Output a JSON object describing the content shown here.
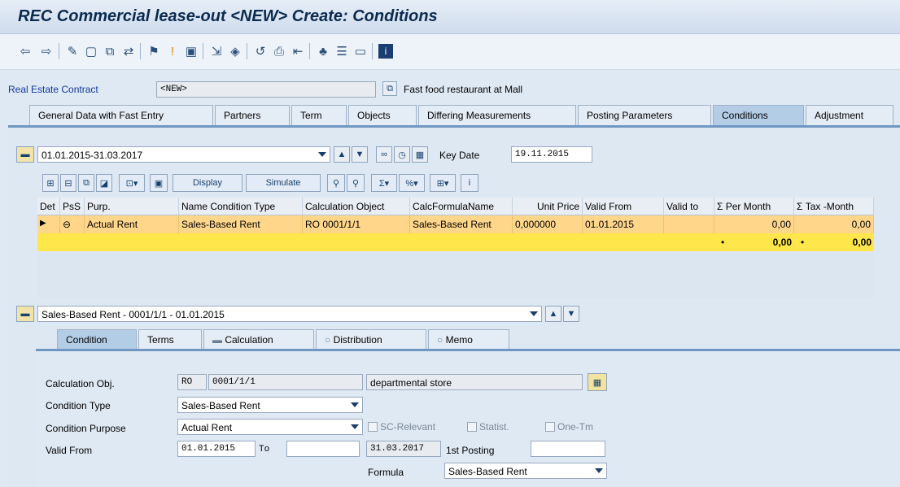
{
  "window": {
    "title": "REC Commercial lease-out <NEW> Create: Conditions"
  },
  "toolbar": {
    "icons": [
      "back-arrow-icon",
      "forward-arrow-icon",
      "edit-icon",
      "new-doc-icon",
      "copy-icon",
      "display-change-icon",
      "release-icon",
      "info-icon",
      "save-icon",
      "check-icon",
      "object-icon",
      "undo-icon",
      "print-icon",
      "find-icon",
      "hierarchy-icon",
      "layout-icon",
      "screen-icon",
      "help-icon"
    ]
  },
  "contract": {
    "label": "Real Estate Contract",
    "number": "<NEW>",
    "description": "Fast food restaurant at Mall"
  },
  "main_tabs": [
    "General Data with Fast Entry",
    "Partners",
    "Term",
    "Objects",
    "Differing Measurements",
    "Posting Parameters",
    "Conditions",
    "Adjustment"
  ],
  "active_main_tab": "Conditions",
  "period": {
    "value": "01.01.2015-31.03.2017",
    "key_date_label": "Key Date",
    "key_date": "19.11.2015"
  },
  "grid_toolbar": {
    "display": "Display",
    "simulate": "Simulate"
  },
  "grid": {
    "headers": [
      "Det",
      "PsS",
      "Purp.",
      "Name Condition Type",
      "Calculation Object",
      "CalcFormulaName",
      "Unit Price",
      "Valid From",
      "Valid to",
      "Σ Per Month",
      "Σ Tax -Month"
    ],
    "row": {
      "purpose": "Actual Rent",
      "condition_type": "Sales-Based Rent",
      "calc_object": "RO 0001/1/1",
      "formula": "Sales-Based Rent",
      "unit_price": "0,000000",
      "valid_from": "01.01.2015",
      "valid_to": "",
      "per_month": "0,00",
      "tax_month": "0,00"
    },
    "totals": {
      "per_month": "0,00",
      "tax_month": "0,00"
    }
  },
  "detail": {
    "selector": "Sales-Based Rent - 0001/1/1 - 01.01.2015",
    "tabs": [
      "Condition",
      "Terms",
      "Calculation",
      "Distribution",
      "Memo"
    ],
    "active_tab": "Condition",
    "calc_obj_label": "Calculation Obj.",
    "calc_obj_type": "RO",
    "calc_obj_id": "0001/1/1",
    "calc_obj_desc": "departmental store",
    "cond_type_label": "Condition Type",
    "cond_type": "Sales-Based Rent",
    "cond_purpose_label": "Condition Purpose",
    "cond_purpose": "Actual Rent",
    "sc_relevant": "SC-Relevant",
    "statist": "Statist.",
    "one_tm": "One-Tm",
    "valid_from_label": "Valid From",
    "valid_from": "01.01.2015",
    "to_label": "To",
    "to_value": "",
    "end_date": "31.03.2017",
    "first_posting_label": "1st Posting",
    "first_posting": "",
    "formula_label": "Formula",
    "formula": "Sales-Based Rent"
  }
}
